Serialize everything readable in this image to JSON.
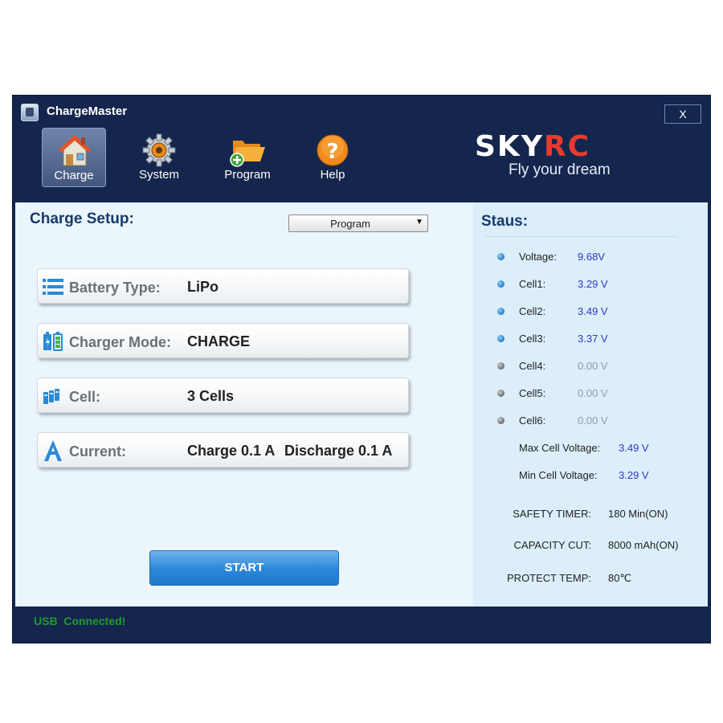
{
  "window": {
    "title": "ChargeMaster",
    "close_label": "X"
  },
  "nav": [
    {
      "label": "Charge",
      "icon": "home-icon",
      "active": true
    },
    {
      "label": "System",
      "icon": "gear-icon",
      "active": false
    },
    {
      "label": "Program",
      "icon": "folder-add-icon",
      "active": false
    },
    {
      "label": "Help",
      "icon": "help-icon",
      "active": false
    }
  ],
  "brand": {
    "logo_sky": "SKY",
    "logo_rc": "RC",
    "tagline": "Fly your dream",
    "accent": "#e63b2e"
  },
  "charge_setup": {
    "title": "Charge Setup:",
    "program_select": "Program",
    "rows": [
      {
        "label": "Battery Type:",
        "value": "LiPo",
        "icon": "list-icon"
      },
      {
        "label": "Charger Mode:",
        "value": "CHARGE",
        "icon": "battery-mode-icon"
      },
      {
        "label": "Cell:",
        "value": "3 Cells",
        "icon": "cells-icon"
      },
      {
        "label": "Current:",
        "value": "Charge 0.1 A",
        "value2": "Discharge 0.1 A",
        "icon": "current-icon"
      }
    ],
    "start_label": "START"
  },
  "status": {
    "title": "Staus:",
    "voltage": {
      "label": "Voltage:",
      "value": "9.68V"
    },
    "cells": [
      {
        "label": "Cell1:",
        "value": "3.29 V",
        "active": true
      },
      {
        "label": "Cell2:",
        "value": "3.49 V",
        "active": true
      },
      {
        "label": "Cell3:",
        "value": "3.37 V",
        "active": true
      },
      {
        "label": "Cell4:",
        "value": "0.00 V",
        "active": false
      },
      {
        "label": "Cell5:",
        "value": "0.00 V",
        "active": false
      },
      {
        "label": "Cell6:",
        "value": "0.00 V",
        "active": false
      }
    ],
    "max_cell": {
      "label": "Max Cell Voltage:",
      "value": "3.49 V"
    },
    "min_cell": {
      "label": "Min Cell Voltage:",
      "value": "3.29 V"
    },
    "safety_timer": {
      "label": "SAFETY TIMER:",
      "value": "180 Min(ON)"
    },
    "capacity_cut": {
      "label": "CAPACITY CUT:",
      "value": "8000 mAh(ON)"
    },
    "protect_temp": {
      "label": "PROTECT TEMP:",
      "value": "80℃"
    }
  },
  "status_bar": {
    "text": "USB  Connected!"
  },
  "colors": {
    "frame": "#14264d",
    "panel": "#eaf5fc",
    "status_panel": "#dbeefa",
    "value_blue": "#2d39c7",
    "connected_green": "#1f9c2a"
  }
}
